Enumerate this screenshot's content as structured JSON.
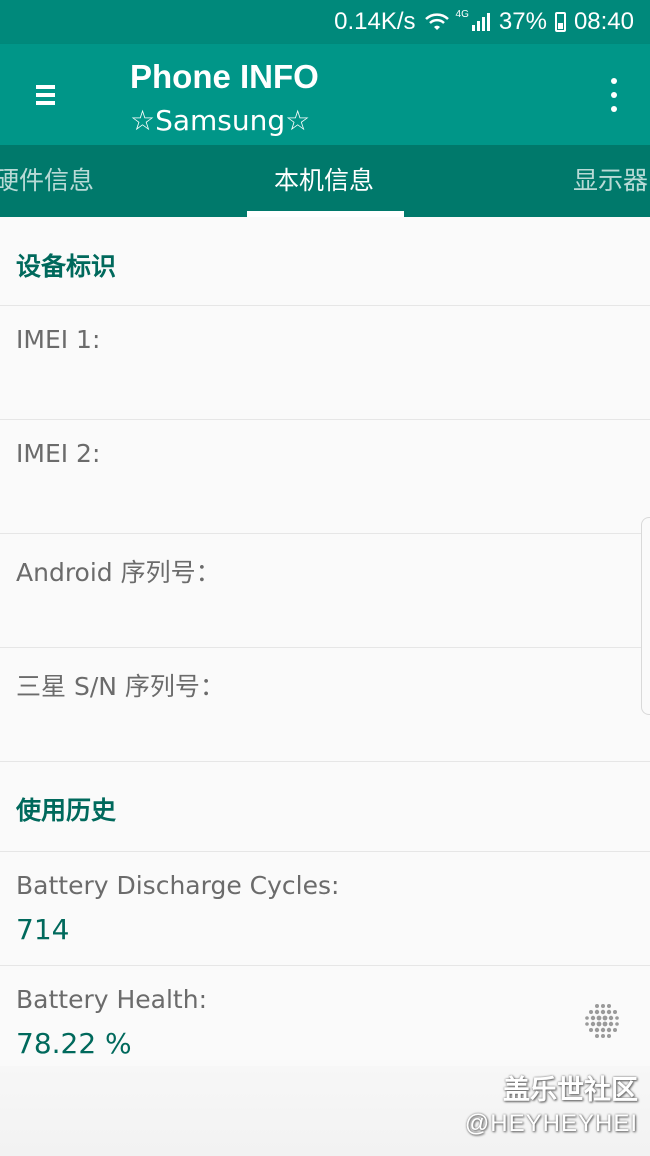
{
  "status_bar": {
    "net_speed": "0.14K/s",
    "network_type": "4G",
    "battery_percent": "37%",
    "battery_level": 0.37,
    "time": "08:40",
    "icons": [
      "wifi-icon",
      "signal-icon",
      "battery-icon"
    ]
  },
  "toolbar": {
    "title": "Phone INFO",
    "subtitle": "☆Samsung☆",
    "menu_icon": "hamburger-menu-icon",
    "overflow_icon": "more-vertical-icon"
  },
  "tabs": [
    {
      "label": "硬件信息",
      "active": false
    },
    {
      "label": "本机信息",
      "active": true
    },
    {
      "label": "显示器",
      "active": false
    }
  ],
  "sections": [
    {
      "header": "设备标识",
      "items": [
        {
          "label": "IMEI 1:",
          "value": ""
        },
        {
          "label": "IMEI 2:",
          "value": ""
        },
        {
          "label": "Android 序列号：",
          "value": ""
        },
        {
          "label": "三星 S/N 序列号：",
          "value": ""
        }
      ]
    },
    {
      "header": "使用历史",
      "items": [
        {
          "label": "Battery Discharge Cycles:",
          "value": "714"
        },
        {
          "label": "Battery Health:",
          "value": "78.22 %"
        }
      ]
    }
  ],
  "watermark": {
    "line1": "盖乐世社区",
    "line2": "@HEYHEYHEI"
  },
  "colors": {
    "status_bar": "#00897b",
    "toolbar": "#009688",
    "tab_bar": "#00796b",
    "accent_text": "#00695c",
    "background": "#fafafa"
  }
}
